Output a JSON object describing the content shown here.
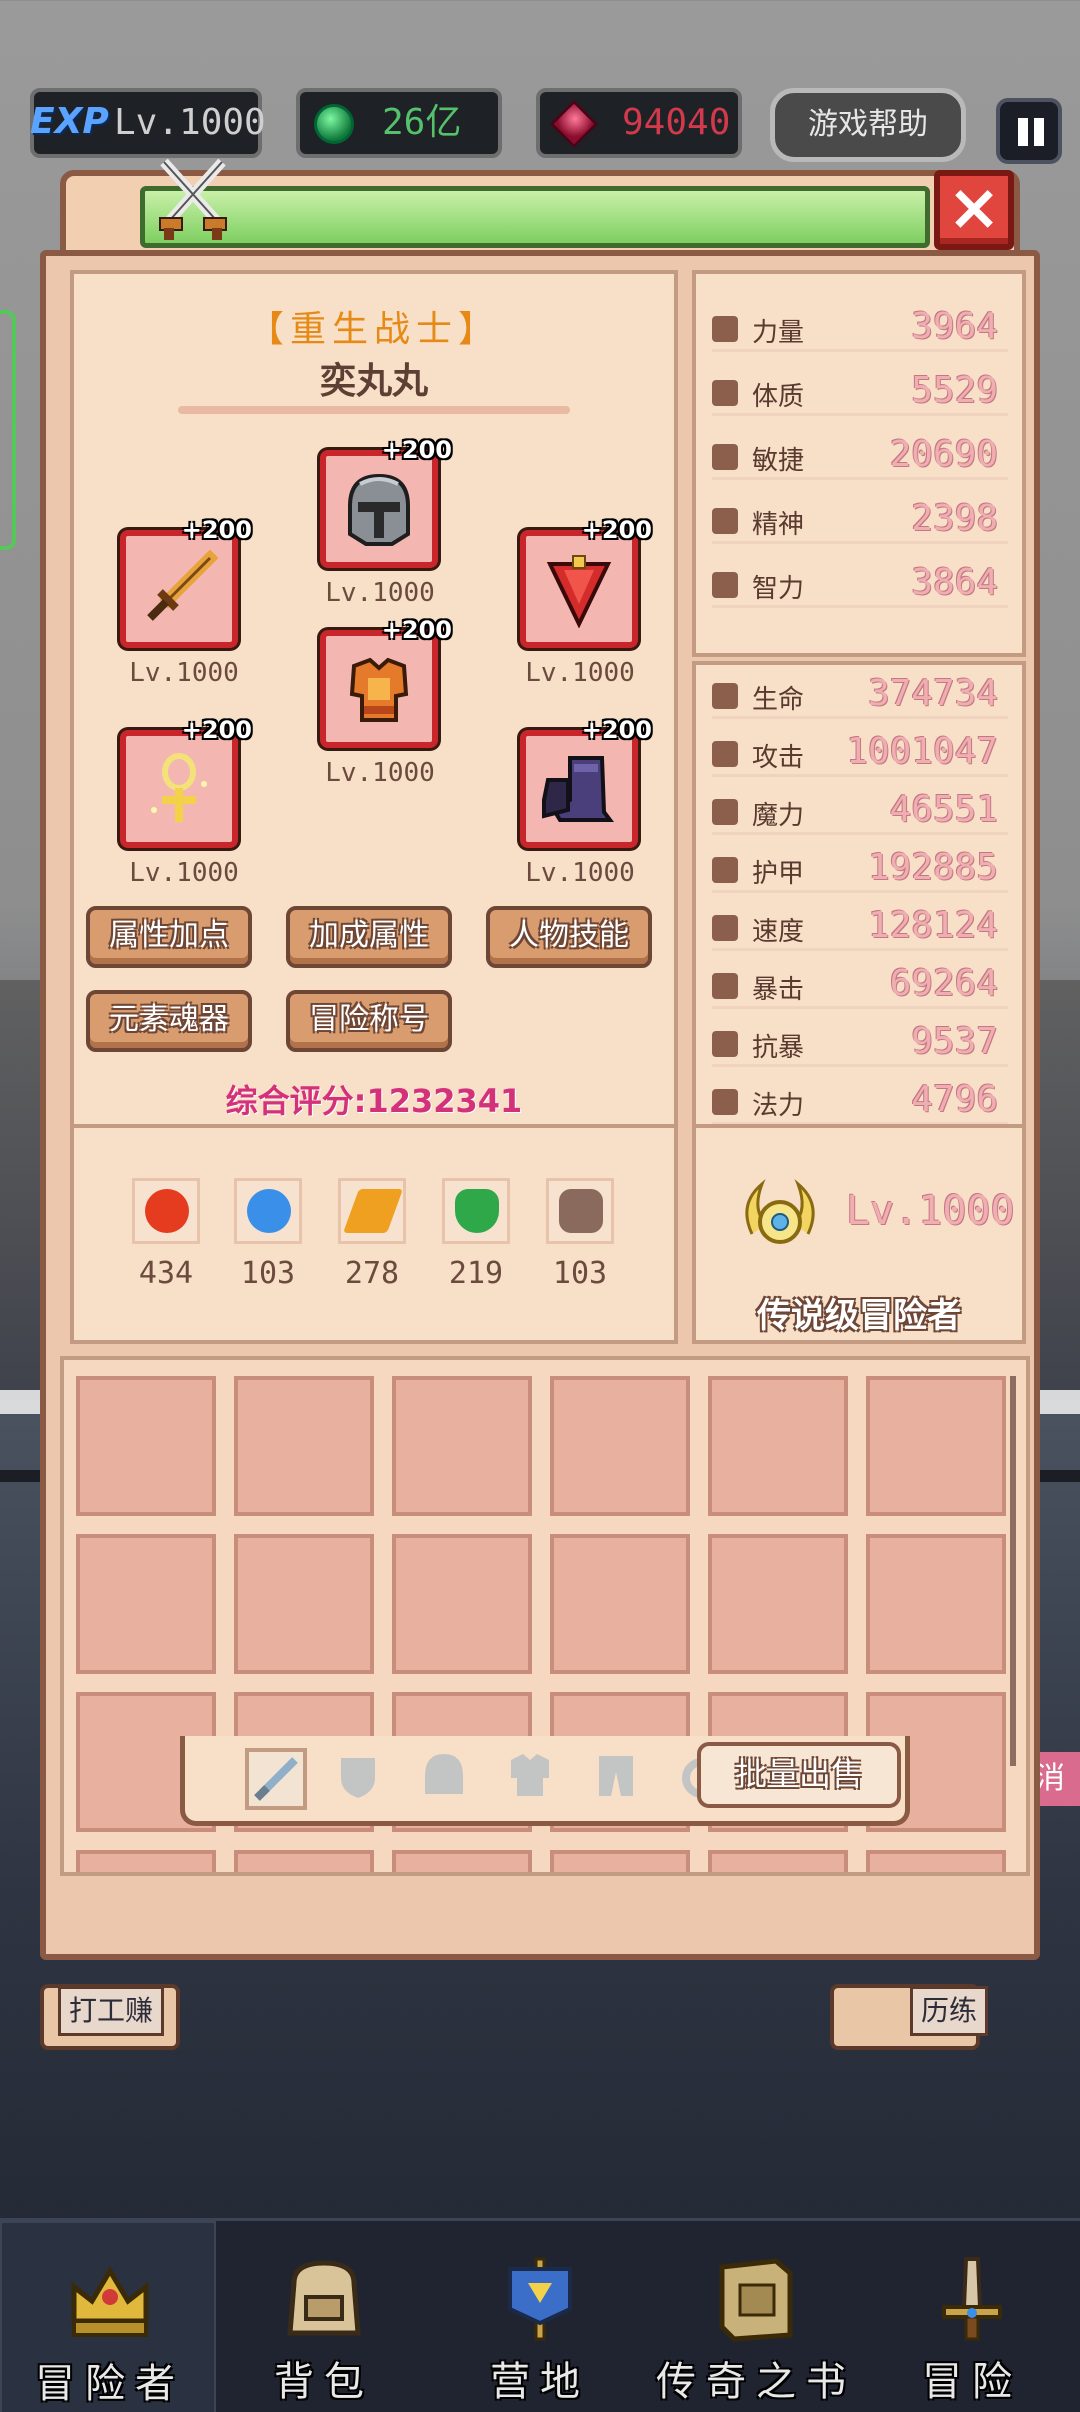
{
  "hud": {
    "exp_badge": "EXP",
    "level": "Lv.1000",
    "emerald": "26亿",
    "ruby": "94040",
    "help": "游戏帮助"
  },
  "hero": {
    "class_name": "【重生战士】",
    "name": "奕丸丸",
    "score": "综合评分:1232341"
  },
  "equipment": [
    {
      "slot": "helmet",
      "plus": "+200",
      "level": "Lv.1000",
      "icon": "helmet-icon"
    },
    {
      "slot": "weapon",
      "plus": "+200",
      "level": "Lv.1000",
      "icon": "sword-icon"
    },
    {
      "slot": "amulet",
      "plus": "+200",
      "level": "Lv.1000",
      "icon": "red-pendant-icon"
    },
    {
      "slot": "armor",
      "plus": "+200",
      "level": "Lv.1000",
      "icon": "armor-icon"
    },
    {
      "slot": "ring",
      "plus": "+200",
      "level": "Lv.1000",
      "icon": "ankh-ring-icon"
    },
    {
      "slot": "boots",
      "plus": "+200",
      "level": "Lv.1000",
      "icon": "boots-icon"
    }
  ],
  "actions": [
    "属性加点",
    "加成属性",
    "人物技能",
    "元素魂器",
    "冒险称号"
  ],
  "base_stats": [
    {
      "label": "力量",
      "value": "3964"
    },
    {
      "label": "体质",
      "value": "5529"
    },
    {
      "label": "敏捷",
      "value": "20690"
    },
    {
      "label": "精神",
      "value": "2398"
    },
    {
      "label": "智力",
      "value": "3864"
    }
  ],
  "combat_stats": [
    {
      "label": "生命",
      "value": "374734"
    },
    {
      "label": "攻击",
      "value": "1001047"
    },
    {
      "label": "魔力",
      "value": "46551"
    },
    {
      "label": "护甲",
      "value": "192885"
    },
    {
      "label": "速度",
      "value": "128124"
    },
    {
      "label": "暴击",
      "value": "69264"
    },
    {
      "label": "抗暴",
      "value": "9537"
    },
    {
      "label": "法力",
      "value": "4796"
    }
  ],
  "elements": [
    {
      "icon": "fire-icon",
      "value": "434",
      "color": "#e53b1f"
    },
    {
      "icon": "water-icon",
      "value": "103",
      "color": "#3a8fe8"
    },
    {
      "icon": "lightning-icon",
      "value": "278",
      "color": "#f0a020"
    },
    {
      "icon": "earth-icon",
      "value": "219",
      "color": "#2fa84a"
    },
    {
      "icon": "skull-icon",
      "value": "103",
      "color": "#8a6a5c"
    }
  ],
  "rank": {
    "level": "Lv.1000",
    "title": "传说级冒险者"
  },
  "inventory_tabs": [
    "sword-tab-icon",
    "shield-tab-icon",
    "helmet-tab-icon",
    "armor-tab-icon",
    "pants-tab-icon",
    "ring-tab-icon"
  ],
  "sell_all": "批量出售",
  "bg": {
    "left_label": "打工赚",
    "right_label": "历练",
    "side_tag": "消"
  },
  "nav": [
    {
      "label": "冒险者",
      "icon": "crown-icon"
    },
    {
      "label": "背包",
      "icon": "backpack-icon"
    },
    {
      "label": "营地",
      "icon": "banner-icon"
    },
    {
      "label": "传奇之书",
      "icon": "book-icon"
    },
    {
      "label": "冒险",
      "icon": "sword-hilt-icon"
    }
  ],
  "colors": {
    "panel": "#ecc7ad",
    "accent_gold": "#e68a15",
    "score_pink": "#d3317a",
    "slot_red": "#c8262a"
  }
}
